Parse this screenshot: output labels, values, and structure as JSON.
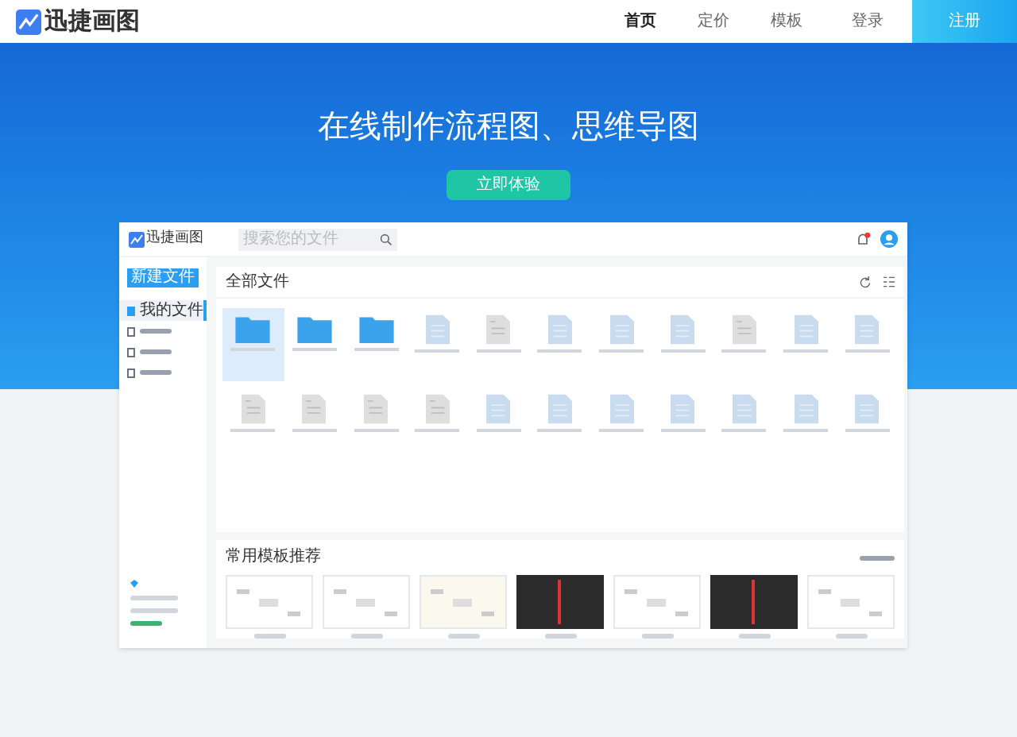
{
  "header": {
    "logo": "迅捷画图",
    "nav": [
      {
        "label": "首页",
        "selected": true
      },
      {
        "label": "定价",
        "selected": false
      },
      {
        "label": "模板",
        "selected": false
      },
      {
        "label": "登录",
        "selected": false
      }
    ],
    "register": "注册"
  },
  "hero": {
    "title": "在线制作流程图、思维导图",
    "button": "立即体验"
  },
  "app": {
    "logo": "迅捷画图",
    "search": {
      "placeholder": "搜索您的文件"
    },
    "new_button": "新建文件",
    "sidebar": {
      "items": [
        {
          "label": "我的文件",
          "selected": true
        },
        {
          "selected": false
        },
        {
          "selected": false
        },
        {
          "selected": false
        }
      ]
    },
    "section_title": "全部文件",
    "files": [
      {
        "kind": "folder",
        "selected": true
      },
      {
        "kind": "folder",
        "selected": false
      },
      {
        "kind": "folder",
        "selected": false
      },
      {
        "kind": "flow",
        "selected": false
      },
      {
        "kind": "doc",
        "selected": false
      },
      {
        "kind": "flow",
        "selected": false
      },
      {
        "kind": "flow",
        "selected": false
      },
      {
        "kind": "flow",
        "selected": false
      },
      {
        "kind": "doc",
        "selected": false
      },
      {
        "kind": "flow",
        "selected": false
      },
      {
        "kind": "flow",
        "selected": false
      },
      {
        "kind": "doc",
        "selected": false
      },
      {
        "kind": "doc",
        "selected": false
      },
      {
        "kind": "doc",
        "selected": false
      },
      {
        "kind": "doc",
        "selected": false
      },
      {
        "kind": "flow",
        "selected": false
      },
      {
        "kind": "flow",
        "selected": false
      },
      {
        "kind": "flow",
        "selected": false
      },
      {
        "kind": "flow",
        "selected": false
      },
      {
        "kind": "flow",
        "selected": false
      },
      {
        "kind": "flow",
        "selected": false
      },
      {
        "kind": "flow",
        "selected": false
      }
    ],
    "templates_title": "常用模板推荐",
    "templates": [
      {
        "kind": "light"
      },
      {
        "kind": "light"
      },
      {
        "kind": "cream"
      },
      {
        "kind": "dark"
      },
      {
        "kind": "light"
      },
      {
        "kind": "dark"
      },
      {
        "kind": "light"
      }
    ]
  }
}
